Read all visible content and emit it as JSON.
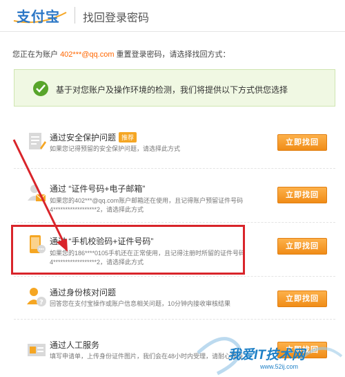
{
  "header": {
    "logo_text": "支付宝",
    "title": "找回登录密码"
  },
  "account": {
    "prefix": "您正在为账户 ",
    "account": "402***@qq.com",
    "suffix": " 重置登录密码，请选择找回方式："
  },
  "notice": {
    "text": "基于对您账户及操作环境的检测，我们将提供以下方式供您选择"
  },
  "options": [
    {
      "title": "通过安全保护问题",
      "tag": "推荐",
      "desc": "如果您记得预留的安全保护问题，请选择此方式",
      "button": "立即找回",
      "icon": "document-edit-icon"
    },
    {
      "title": "通过 “证件号码+电子邮箱”",
      "desc": "如果您的402***@qq.com账户邮箱还在使用，且记得账户预留证件号码 4******************2，请选择此方式",
      "button": "立即找回",
      "icon": "user-mail-icon"
    },
    {
      "title": "通过 “手机校验码+证件号码”",
      "desc": "如果您的186****0105手机还在正常使用，且记得注册时所留的证件号码 4******************2，请选择此方式",
      "button": "立即找回",
      "icon": "mobile-phone-icon"
    },
    {
      "title": "通过身份核对问题",
      "desc": "回答您在支付宝操作或账户信息相关问题，10分钟内接收审核结果",
      "button": "立即找回",
      "icon": "user-question-icon"
    },
    {
      "title": "通过人工服务",
      "desc": "填写申请单，上传身份证件图片，我们会在48小时内受理，请耐心等待",
      "button": "立即找回",
      "icon": "id-card-icon"
    }
  ],
  "watermark": {
    "text": "我爱IT技术网",
    "url": "www.52ij.com"
  },
  "colors": {
    "brand": "#2b77c6",
    "accent": "#f08c17",
    "highlight": "#d9242a",
    "success": "#58a52b"
  }
}
